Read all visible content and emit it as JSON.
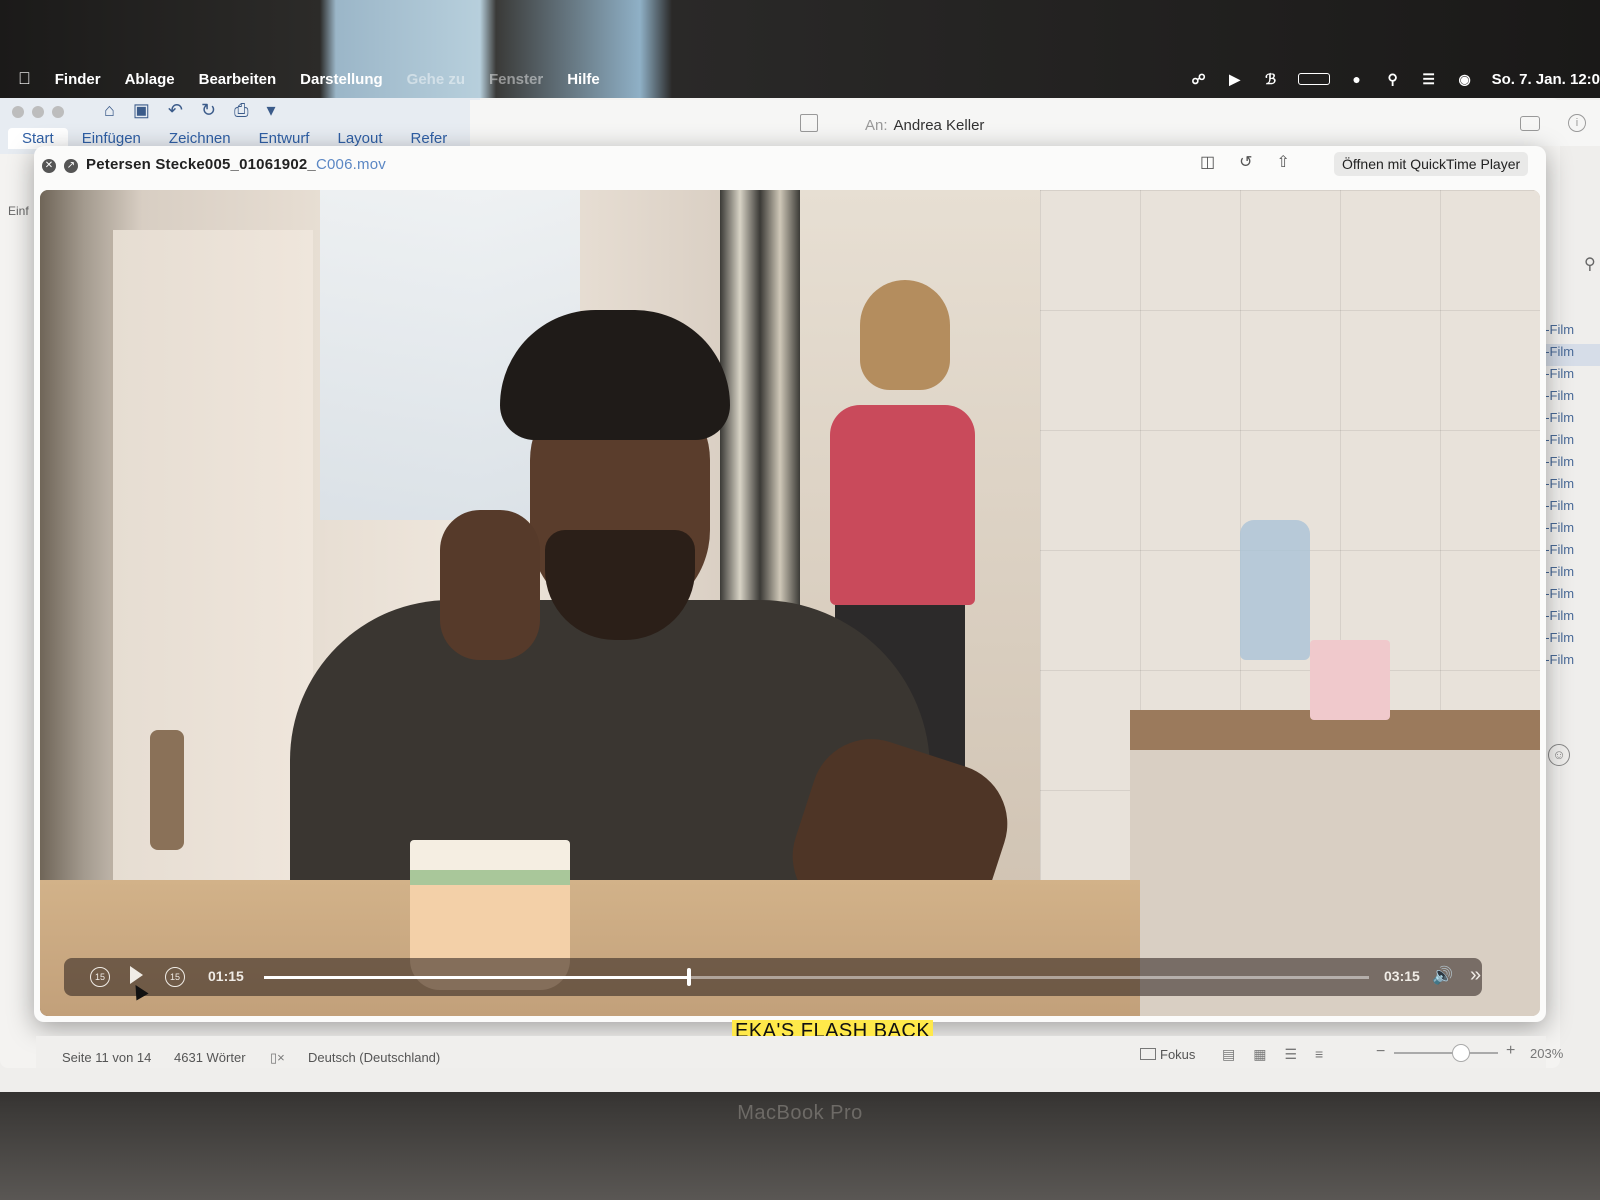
{
  "menubar": {
    "apple": "",
    "app": "Finder",
    "items": [
      "Ablage",
      "Bearbeiten",
      "Darstellung",
      "Gehe zu",
      "Fenster",
      "Hilfe"
    ],
    "clock": "So. 7. Jan. 12:0"
  },
  "word": {
    "ribbon_tabs": [
      "Start",
      "Einfügen",
      "Zeichnen",
      "Entwurf",
      "Layout",
      "Refer"
    ],
    "left_fragment": "Einf",
    "status": {
      "page": "Seite 11 von 14",
      "words": "4631 Wörter",
      "language": "Deutsch (Deutschland)",
      "focus": "Fokus",
      "zoom": "203%"
    }
  },
  "mail": {
    "to_label": "An:",
    "to_value": "Andrea Keller",
    "list_items": [
      "e-Film",
      "e-Film",
      "e-Film",
      "e-Film",
      "e-Film",
      "e-Film",
      "e-Film",
      "e-Film",
      "e-Film",
      "e-Film",
      "e-Film",
      "e-Film",
      "e-Film",
      "e-Film",
      "e-Film",
      "e-Film"
    ]
  },
  "quicklook": {
    "title_main": "Petersen Stecke005_01061902_",
    "title_ext": "C006.mov",
    "open_button": "Öffnen mit QuickTime Player"
  },
  "player": {
    "elapsed": "01:15",
    "total": "03:15",
    "progress": 0.385,
    "skip_seconds": "15"
  },
  "subtitle": "EKA'S FLASH BACK",
  "device_label": "MacBook Pro",
  "colors": {
    "subtitle_bg": "#ffe94a",
    "link_blue": "#5b87c4",
    "ribbon_blue": "#2f5fa5"
  }
}
